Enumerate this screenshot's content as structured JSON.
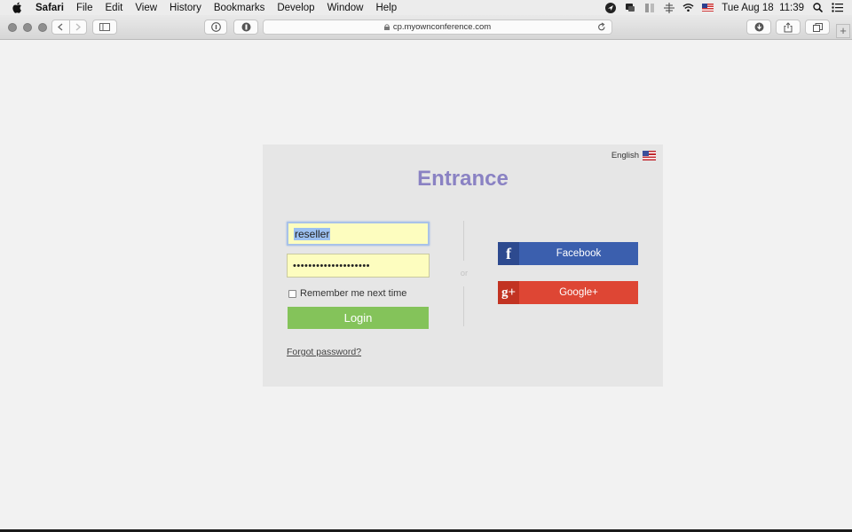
{
  "menubar": {
    "app": "Safari",
    "items": [
      "File",
      "Edit",
      "View",
      "History",
      "Bookmarks",
      "Develop",
      "Window",
      "Help"
    ],
    "clock": "Tue Aug 18  11:39"
  },
  "browser": {
    "url": "cp.myownconference.com"
  },
  "login": {
    "language": "English",
    "title": "Entrance",
    "username_value": "reseller",
    "password_mask": "••••••••••••••••••••",
    "remember_label": "Remember me next time",
    "login_label": "Login",
    "forgot_label": "Forgot password?",
    "or_label": "or",
    "facebook_label": "Facebook",
    "facebook_icon": "f",
    "google_label": "Google+",
    "google_icon": "g+"
  },
  "colors": {
    "title": "#8a82c3",
    "login_button": "#84c35a",
    "facebook": "#3b5fae",
    "google": "#de4634",
    "field_bg": "#fdfdbf"
  }
}
